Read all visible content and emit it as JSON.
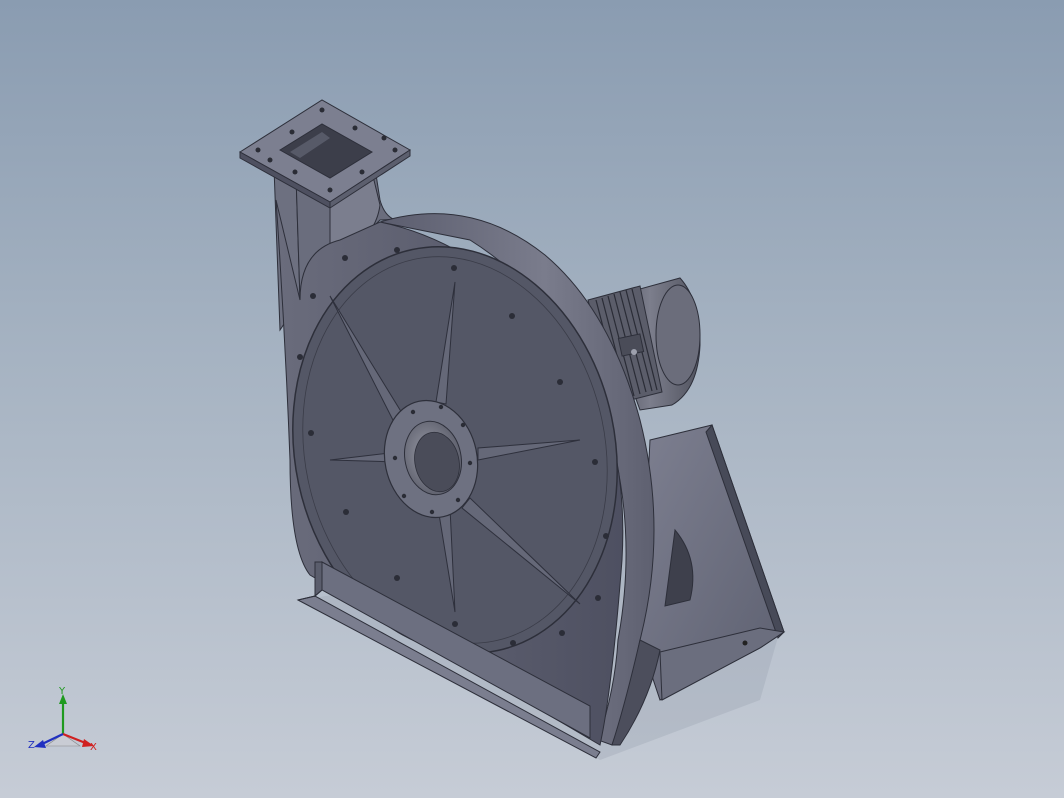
{
  "viewport": {
    "background_top": "#8a9cb1",
    "background_bottom": "#c6ccd6"
  },
  "model": {
    "name": "centrifugal-fan-assembly",
    "body_color": "#5a5d6c"
  },
  "triad": {
    "x_label": "X",
    "y_label": "Y",
    "z_label": "Z",
    "x_color": "#d02020",
    "y_color": "#1f9a1f",
    "z_color": "#2030c0"
  }
}
